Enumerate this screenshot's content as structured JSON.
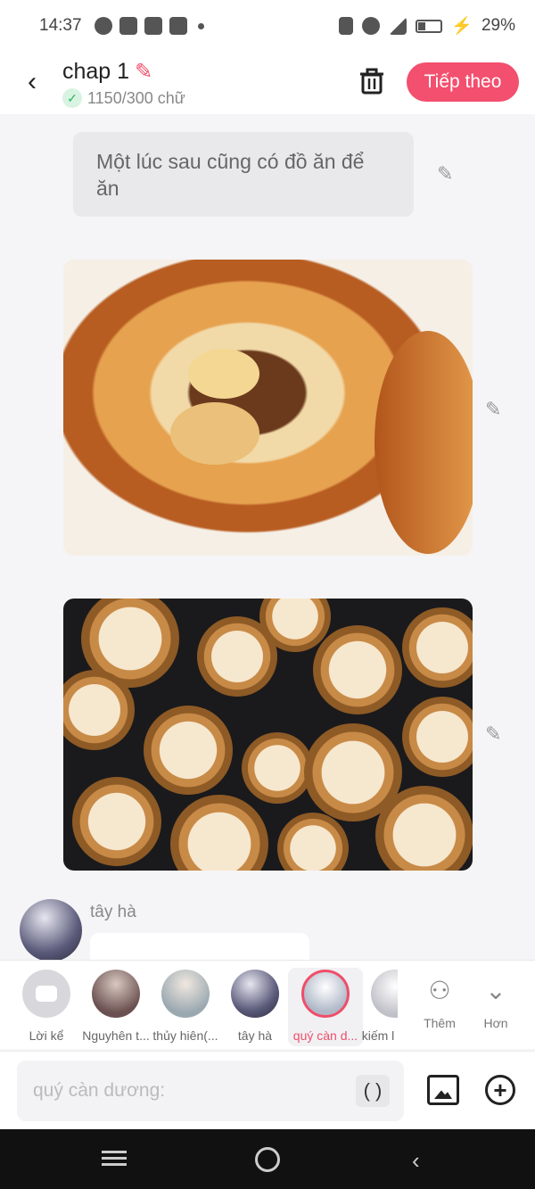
{
  "status_bar": {
    "time": "14:37",
    "battery": "29%",
    "icons": [
      "messenger-icon",
      "facebook-icon",
      "app-icon",
      "youtube-icon",
      "dot-icon",
      "vibrate-icon",
      "wifi-icon",
      "signal-icon",
      "battery-icon",
      "charging-icon"
    ]
  },
  "header": {
    "title": "chap 1",
    "word_count": "1150/300 chữ",
    "next_label": "Tiếp theo"
  },
  "messages": [
    {
      "type": "text",
      "text": "Một lúc sau cũng có đồ ăn để ăn"
    },
    {
      "type": "image",
      "subject": "food-pot-image"
    },
    {
      "type": "image",
      "subject": "dim-sum-image"
    },
    {
      "type": "comment",
      "author": "tây hà"
    }
  ],
  "characters": [
    {
      "label": "Lời kể",
      "selected": false
    },
    {
      "label": "Nguyhên t...",
      "selected": false
    },
    {
      "label": "thủy hiên(...",
      "selected": false
    },
    {
      "label": "tây hà",
      "selected": false
    },
    {
      "label": "quý càn d...",
      "selected": true
    },
    {
      "label": "kiếm l",
      "selected": false
    }
  ],
  "tray_actions": {
    "add_label": "Thêm",
    "more_label": "Hơn"
  },
  "input": {
    "placeholder": "quý càn dương:",
    "paren": "( )"
  },
  "colors": {
    "accent": "#f34f6e",
    "background": "#f5f5f7"
  }
}
